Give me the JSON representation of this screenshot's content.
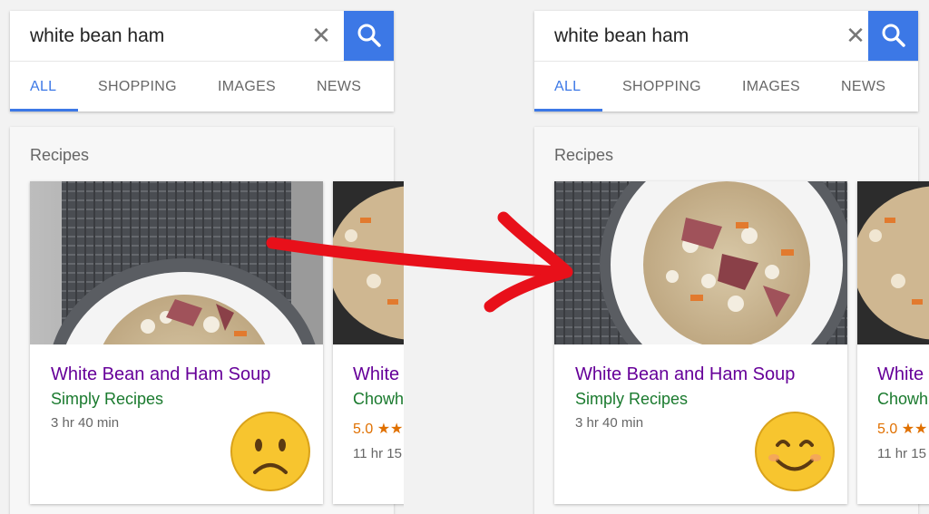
{
  "search": {
    "query": "white bean ham",
    "clear_glyph": "✕"
  },
  "tabs": [
    {
      "label": "ALL",
      "active": true
    },
    {
      "label": "SHOPPING",
      "active": false
    },
    {
      "label": "IMAGES",
      "active": false
    },
    {
      "label": "NEWS",
      "active": false
    }
  ],
  "recipes": {
    "heading": "Recipes",
    "items": [
      {
        "title": "White Bean and Ham Soup",
        "source": "Simply Recipes",
        "time": "3 hr 40 min"
      },
      {
        "title": "White",
        "source": "Chowh",
        "rating": "5.0 ★★",
        "time": "11 hr 15"
      }
    ]
  },
  "panels": {
    "before": {
      "reaction": "frowning-face-icon"
    },
    "after": {
      "reaction": "smiling-face-icon"
    }
  },
  "colors": {
    "accent_blue": "#3c78e6",
    "title_purple": "#660099",
    "source_green": "#1a7a2e",
    "rating_orange": "#e07000",
    "arrow_red": "#e8101a"
  }
}
